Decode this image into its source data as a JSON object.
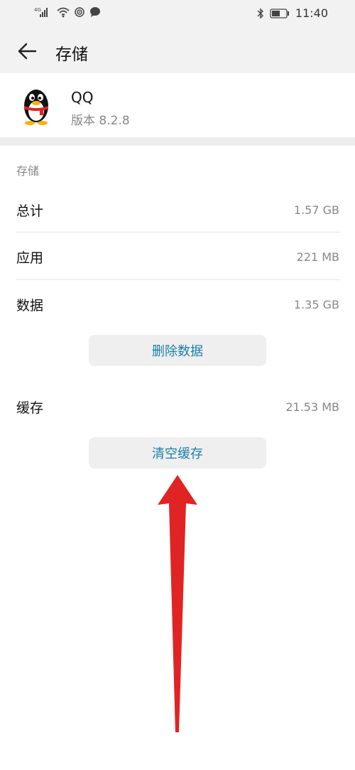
{
  "status_bar": {
    "time": "11:40",
    "network_label": "4G"
  },
  "header": {
    "title": "存储"
  },
  "app": {
    "name": "QQ",
    "version": "版本 8.2.8"
  },
  "storage": {
    "section_label": "存储",
    "rows": [
      {
        "label": "总计",
        "value": "1.57 GB"
      },
      {
        "label": "应用",
        "value": "221 MB"
      },
      {
        "label": "数据",
        "value": "1.35 GB"
      }
    ],
    "delete_data_label": "删除数据",
    "cache": {
      "label": "缓存",
      "value": "21.53 MB"
    },
    "clear_cache_label": "清空缓存"
  },
  "colors": {
    "accent": "#1a7fa6",
    "arrow": "#e02424"
  }
}
